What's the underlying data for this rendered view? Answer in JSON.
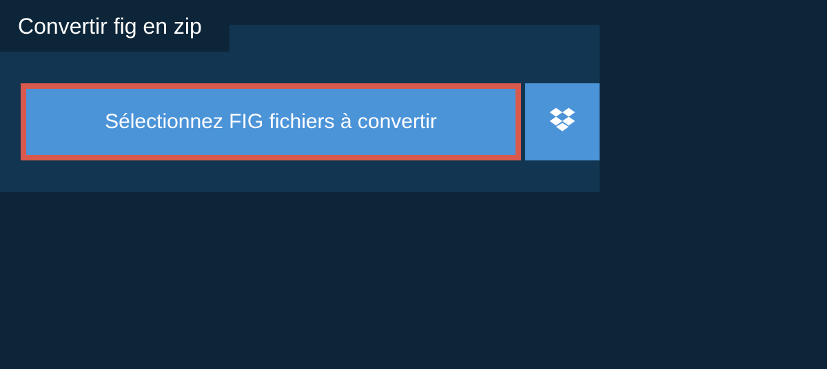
{
  "tab": {
    "title": "Convertir fig en zip"
  },
  "upload": {
    "select_label": "Sélectionnez FIG fichiers à convertir"
  }
}
